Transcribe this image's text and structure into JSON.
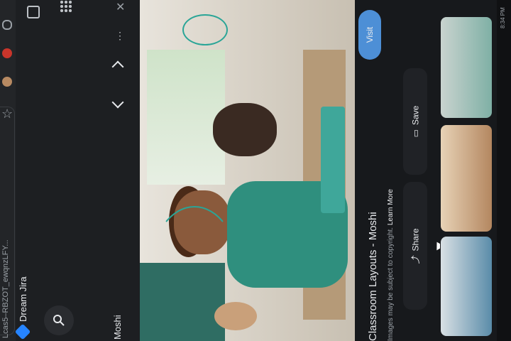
{
  "sidebar": {
    "bookmark_label": "Dream Jira",
    "url_fragment": "Lcas5–RBZOT_ewqnzLFY...",
    "tab_title": "Moshi"
  },
  "image": {
    "alt_subject": "smiling child in classroom"
  },
  "panel": {
    "visit_label": "Visit",
    "save_label": "Save",
    "share_label": "Share",
    "title": "Classroom Layouts - Moshi",
    "copyright_text": "Images may be subject to copyright.",
    "learn_more": "Learn More"
  },
  "status": {
    "clock": "8:34 PM"
  },
  "colors": {
    "accent_blue": "#4d8fd6",
    "panel_bg": "#17191c",
    "chrome_bg": "#1d1f22",
    "teal": "#2aa597"
  },
  "icons": [
    "search-icon",
    "window-icon",
    "apps-grid-icon",
    "close-icon",
    "more-icon",
    "chevron-up-icon",
    "chevron-down-icon",
    "star-icon",
    "save-icon",
    "share-icon",
    "jira-icon"
  ]
}
